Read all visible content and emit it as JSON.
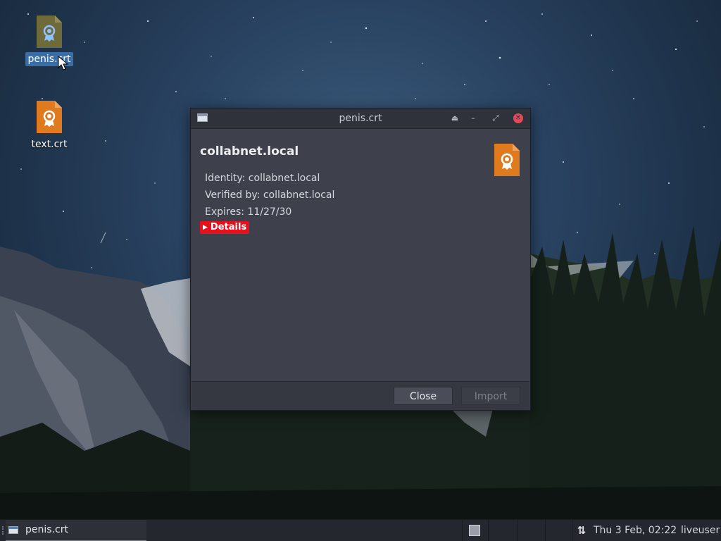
{
  "desktop": {
    "icons": [
      {
        "label": "penis.crt",
        "icon": "certificate-file-icon",
        "selected": true
      },
      {
        "label": "text.crt",
        "icon": "certificate-file-icon",
        "selected": false
      }
    ]
  },
  "window": {
    "title": "penis.crt",
    "controls": {
      "shade": "⏏",
      "minimize": "–",
      "maximize": "⤢",
      "close": "✕"
    },
    "certificate": {
      "name": "collabnet.local",
      "identity": "Identity: collabnet.local",
      "verified_by": "Verified by: collabnet.local",
      "expires": "Expires: 11/27/30",
      "details_label": "Details",
      "details_arrow": "▶"
    },
    "buttons": {
      "close": "Close",
      "import": "Import"
    }
  },
  "taskbar": {
    "task_item": "penis.crt",
    "network_glyph": "⇅",
    "clock": "Thu  3 Feb, 02:22",
    "user": "liveuser"
  },
  "colors": {
    "file_orange": "#e07a1f",
    "file_olive": "#6e6a3a",
    "details_red": "#e8101c",
    "selection_blue": "#3b6ea5"
  }
}
